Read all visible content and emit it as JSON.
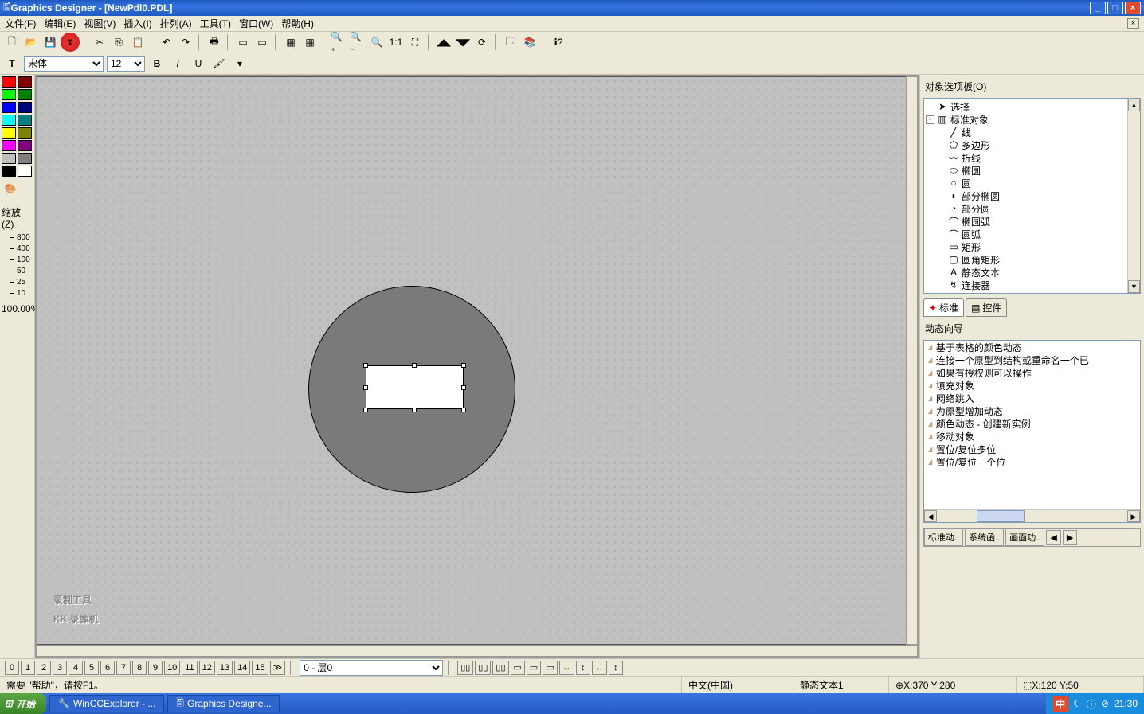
{
  "title": "Graphics Designer - [NewPdl0.PDL]",
  "menu": {
    "file": "文件(F)",
    "edit": "编辑(E)",
    "view": "视图(V)",
    "insert": "插入(I)",
    "arrange": "排列(A)",
    "tool": "工具(T)",
    "window": "窗口(W)",
    "help": "帮助(H)"
  },
  "font": {
    "name": "宋体",
    "size": "12"
  },
  "zoom": {
    "label": "缩放(Z)",
    "ticks": [
      "800",
      "400",
      "100",
      "50",
      "25",
      "10"
    ],
    "current": "100.00%"
  },
  "swatches": [
    "#ff0000",
    "#800000",
    "#00ff00",
    "#008000",
    "#0000ff",
    "#000080",
    "#00ffff",
    "#008080",
    "#ffff00",
    "#808000",
    "#ff00ff",
    "#800080",
    "#c0c0c0",
    "#808080",
    "#000000",
    "#ffffff"
  ],
  "objectpanel": {
    "header": "对象选项板(O)",
    "select": "选择",
    "group": "标准对象",
    "items": [
      "线",
      "多边形",
      "折线",
      "椭圆",
      "圆",
      "部分椭圆",
      "部分圆",
      "椭圆弧",
      "圆弧",
      "矩形",
      "圆角矩形",
      "静态文本",
      "连接器"
    ],
    "tab_std": "标准",
    "tab_ctrl": "控件"
  },
  "wizard": {
    "header": "动态向导",
    "items": [
      "基于表格的颜色动态",
      "连接一个原型到结构或重命名一个已",
      "如果有授权则可以操作",
      "填充对象",
      "网络跳入",
      "为原型增加动态",
      "颜色动态 - 创建新实例",
      "移动对象",
      "置位/复位多位",
      "置位/复位一个位"
    ],
    "tabs": [
      "标准动..",
      "系统函..",
      "画面功.."
    ]
  },
  "layers": {
    "numbers": [
      "0",
      "1",
      "2",
      "3",
      "4",
      "5",
      "6",
      "7",
      "8",
      "9",
      "10",
      "11",
      "12",
      "13",
      "14",
      "15"
    ],
    "more": "≫",
    "current": "0 - 层0"
  },
  "status": {
    "help": "需要 \"帮助\"，请按F1。",
    "lang": "中文(中国)",
    "obj": "静态文本1",
    "mouse": "X:370 Y:280",
    "size": "X:120 Y:50"
  },
  "taskbar": {
    "start": "开始",
    "task1": "WinCCExplorer - ...",
    "task2": "Graphics Designe...",
    "langind": "中",
    "time": "21:30"
  },
  "watermark": {
    "l1": "录制工具",
    "l2": "KK 录像机"
  }
}
